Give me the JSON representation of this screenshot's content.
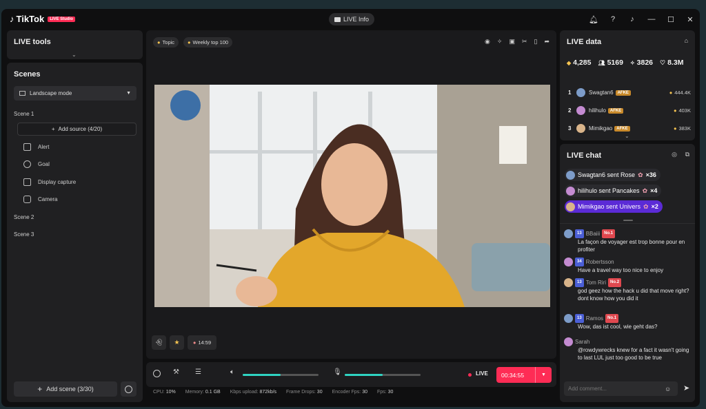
{
  "app": {
    "name": "TikTok",
    "studio_badge": "LIVE Studio",
    "live_info": "LIVE Info"
  },
  "left": {
    "tools_title": "LIVE tools",
    "scenes_title": "Scenes",
    "mode": "Landscape mode",
    "scene1": "Scene 1",
    "add_source": "Add source (4/20)",
    "sources": [
      "Alert",
      "Goal",
      "Display capture",
      "Camera"
    ],
    "scene2": "Scene 2",
    "scene3": "Scene 3",
    "add_scene": "Add scene (3/30)"
  },
  "stage": {
    "chip_topic": "Topic",
    "chip_weekly": "Weekly top 100",
    "timer": "14:59"
  },
  "controls": {
    "live_label": "LIVE",
    "duration": "00:34:55",
    "speaker_level": 0.5,
    "mic_level": 0.5
  },
  "stats": [
    {
      "label": "CPU:",
      "value": "10%"
    },
    {
      "label": "Memory:",
      "value": "0.1 GB"
    },
    {
      "label": "Kbps upload:",
      "value": "872kb/s"
    },
    {
      "label": "Frame Drops:",
      "value": "30"
    },
    {
      "label": "Encoder Fps:",
      "value": "30"
    },
    {
      "label": "Fps:",
      "value": "30"
    }
  ],
  "live_data": {
    "title": "LIVE data",
    "diamonds": "4,285",
    "viewers": "5169",
    "likes_users": "3826",
    "likes": "8.3M",
    "ranking": [
      {
        "rank": "1",
        "name": "Swagtan6",
        "badge": "AFKE",
        "score": "444.4K"
      },
      {
        "rank": "2",
        "name": "hilihulo",
        "badge": "AFKE",
        "score": "403K"
      },
      {
        "rank": "3",
        "name": "Mimikgao",
        "badge": "AFKE",
        "score": "383K"
      }
    ]
  },
  "chat": {
    "title": "LIVE chat",
    "gifts": [
      {
        "text": "Swagtan6 sent Rose",
        "count": "×36",
        "bg": "#2a2a2e"
      },
      {
        "text": "hilihulo sent Pancakes",
        "count": "×4",
        "bg": "#2a2a2e"
      },
      {
        "text": "Mimikgao sent Univers",
        "count": "×2",
        "bg": "#5b2bd6"
      }
    ],
    "messages": [
      {
        "name": "BBaiii",
        "lvl": "13",
        "tag": "No.1",
        "text": "La façon de voyager est trop bonne pour en profiter"
      },
      {
        "name": "Robertsson",
        "lvl": "34",
        "tag": "",
        "text": "Have a travel way too nice to enjoy"
      },
      {
        "name": "Tom Riri",
        "lvl": "13",
        "tag": "No.2",
        "text": "god geez how the hack u did that move right? dont know how you did it"
      },
      {
        "name": "Ramos",
        "lvl": "13",
        "tag": "No.1",
        "text": "Wow, das ist cool, wie geht das?"
      },
      {
        "name": "Sarah",
        "lvl": "",
        "tag": "",
        "text": "@rowdywrecks knew for a fact it wasn't going to last LUL just too good to be true"
      }
    ],
    "placeholder": "Add comment..."
  },
  "colors": {
    "accent": "#fe2c55",
    "teal": "#2fd4c2",
    "gold": "#f5c451"
  }
}
